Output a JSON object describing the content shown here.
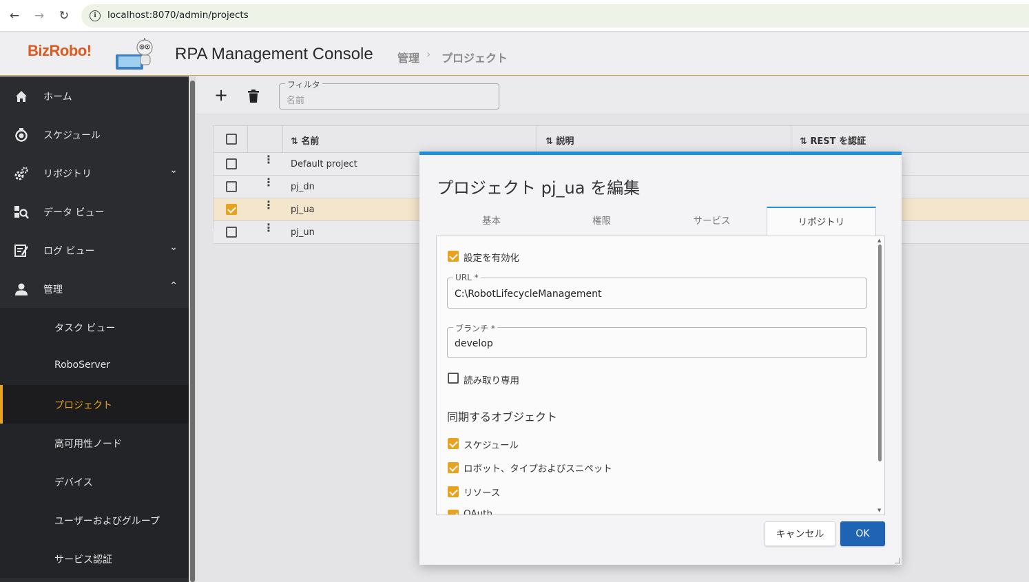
{
  "browser": {
    "url": "localhost:8070/admin/projects",
    "info_icon": "i"
  },
  "header": {
    "logo": "BizRobo!",
    "title": "RPA Management Console",
    "breadcrumb": [
      "管理",
      "プロジェクト"
    ],
    "separator": "›"
  },
  "sidebar": {
    "items": [
      {
        "label": "ホーム",
        "icon": "home-icon"
      },
      {
        "label": "スケジュール",
        "icon": "timer-icon"
      },
      {
        "label": "リポジトリ",
        "icon": "gears-icon",
        "chevron": "⌄"
      },
      {
        "label": "データ ビュー",
        "icon": "data-view-icon"
      },
      {
        "label": "ログ ビュー",
        "icon": "log-view-icon",
        "chevron": "⌄"
      },
      {
        "label": "管理",
        "icon": "person-icon",
        "chevron": "⌃"
      }
    ],
    "sub_items": [
      {
        "label": "タスク ビュー"
      },
      {
        "label": "RoboServer"
      },
      {
        "label": "プロジェクト",
        "active": true
      },
      {
        "label": "高可用性ノード"
      },
      {
        "label": "デバイス"
      },
      {
        "label": "ユーザーおよびグループ"
      },
      {
        "label": "サービス認証"
      }
    ],
    "accent": "#e8a21e"
  },
  "toolbar": {
    "add": "+",
    "filter_label": "フィルタ",
    "filter_placeholder": "名前"
  },
  "table": {
    "columns": [
      "⇅ 名前",
      "⇅ 説明",
      "⇅ REST を認証"
    ],
    "kebab": "⋮",
    "rows": [
      {
        "name": "Default project",
        "selected": false
      },
      {
        "name": "pj_dn",
        "selected": false
      },
      {
        "name": "pj_ua",
        "selected": true
      },
      {
        "name": "pj_un",
        "selected": false
      }
    ]
  },
  "dialog": {
    "title": "プロジェクト pj_ua を編集",
    "tabs": [
      "基本",
      "権限",
      "サービス",
      "リポジトリ"
    ],
    "active_tab": "リポジトリ",
    "enable_label": "設定を有効化",
    "enable_checked": true,
    "url_label": "URL *",
    "url_value": "C:\\RobotLifecycleManagement",
    "branch_label": "ブランチ *",
    "branch_value": "develop",
    "readonly_label": "読み取り専用",
    "readonly_checked": false,
    "sync_heading": "同期するオブジェクト",
    "sync_items": [
      {
        "label": "スケジュール",
        "checked": true
      },
      {
        "label": "ロボット、タイプおよびスニペット",
        "checked": true
      },
      {
        "label": "リソース",
        "checked": true
      },
      {
        "label": "OAuth",
        "checked": true
      }
    ],
    "cancel_label": "キャンセル",
    "ok_label": "OK",
    "accent": "#1e8fd8",
    "ok_color": "#1e63b4"
  }
}
